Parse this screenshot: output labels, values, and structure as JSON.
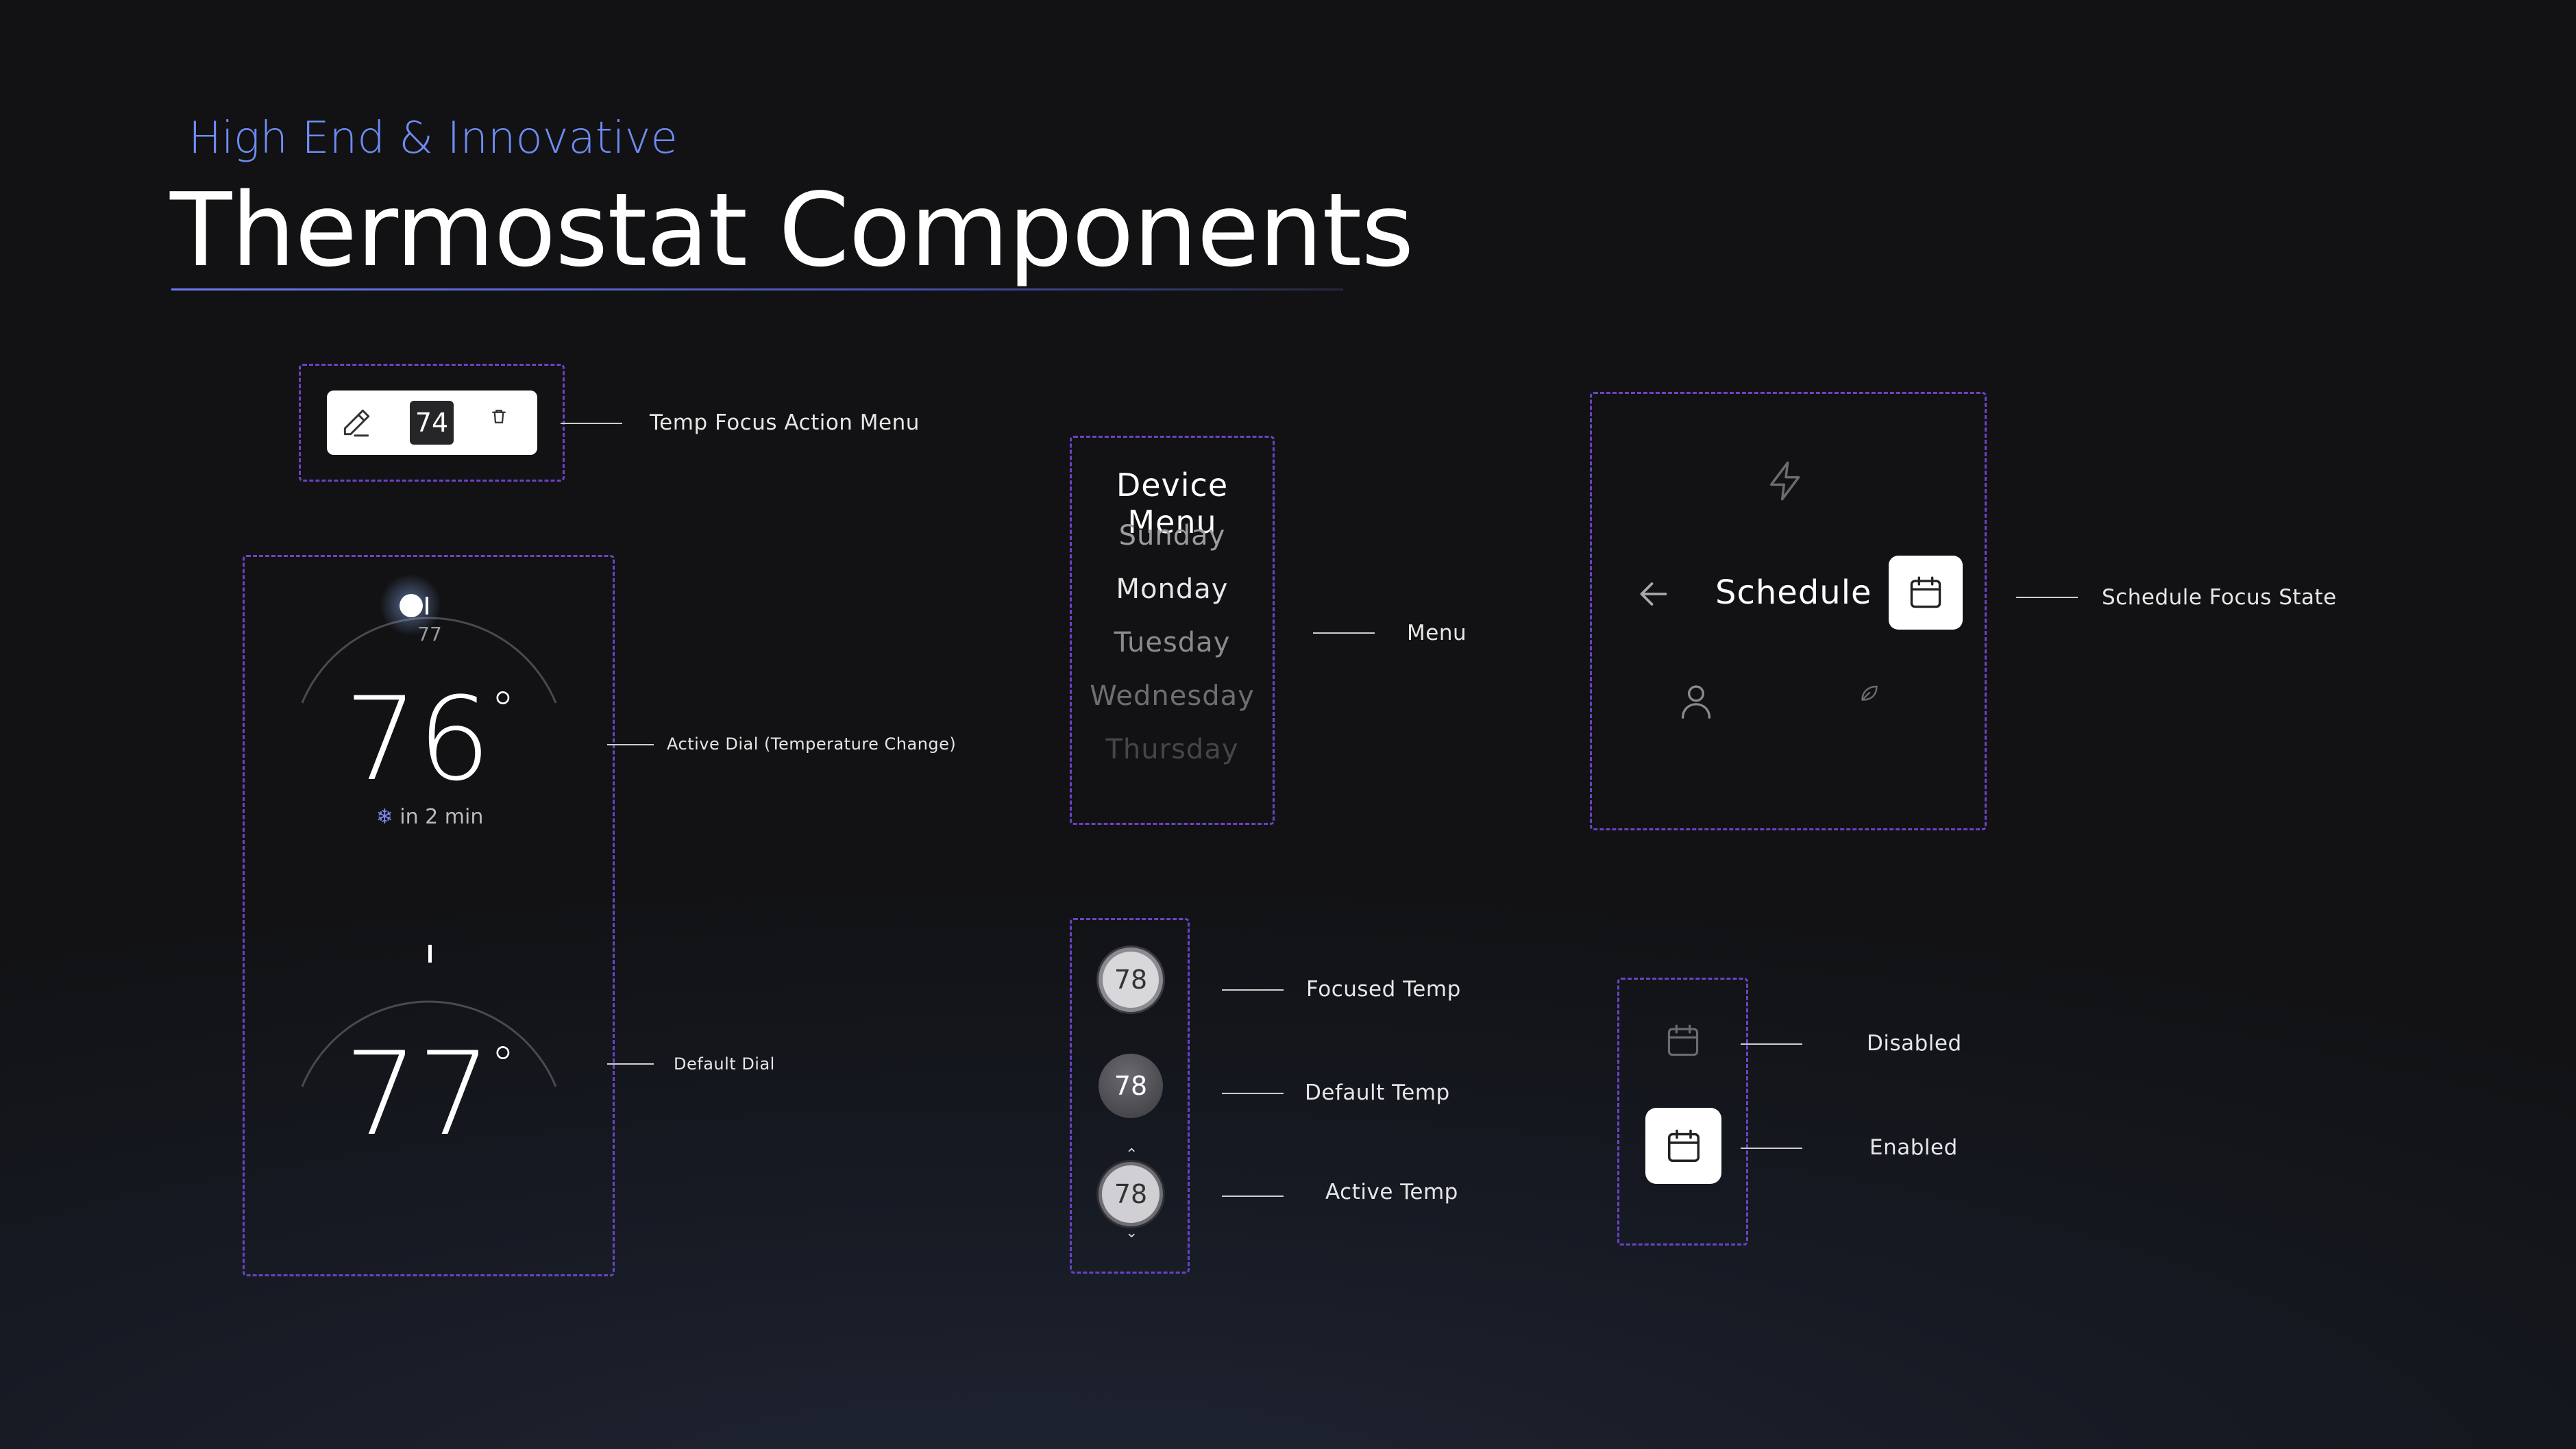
{
  "header": {
    "subtitle": "High End & Innovative",
    "title": "Thermostat Components"
  },
  "action_menu": {
    "value": "74",
    "label": "Temp Focus Action Menu",
    "icons": [
      "pencil-icon",
      "trash-icon"
    ]
  },
  "active_dial": {
    "target_marker": "77",
    "temperature": "76",
    "degree": "°",
    "status_icon": "snowflake-icon",
    "status_text": "in 2 min",
    "label": "Active Dial (Temperature Change)"
  },
  "default_dial": {
    "temperature": "77",
    "degree": "°",
    "label": "Default Dial"
  },
  "device_menu": {
    "title": "Device Menu",
    "items": [
      "Sunday",
      "Monday",
      "Tuesday",
      "Wednesday",
      "Thursday"
    ],
    "selected": "Monday",
    "label": "Menu"
  },
  "temp_knobs": {
    "focused": {
      "value": "78",
      "label": "Focused Temp"
    },
    "default": {
      "value": "78",
      "label": "Default Temp"
    },
    "active": {
      "value": "78",
      "label": "Active Temp"
    }
  },
  "schedule": {
    "title": "Schedule",
    "label": "Schedule Focus State",
    "icons": [
      "lightning-icon",
      "back-arrow-icon",
      "calendar-icon",
      "person-icon",
      "leaf-icon"
    ]
  },
  "calendar_states": {
    "disabled_label": "Disabled",
    "enabled_label": "Enabled"
  },
  "colors": {
    "accent_blue": "#6e8cf2",
    "dashed_border": "#6a44c4",
    "background": "#121214",
    "snowflake": "#7d8df0"
  }
}
